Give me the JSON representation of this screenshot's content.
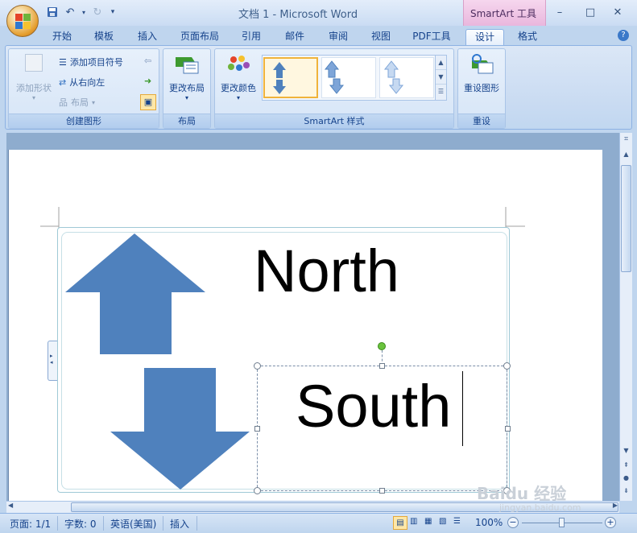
{
  "titlebar": {
    "title": "文档 1 - Microsoft Word",
    "context_tab": "SmartArt 工具",
    "minimize": "–",
    "maximize": "□",
    "close": "✕"
  },
  "tabs": [
    "开始",
    "模板",
    "插入",
    "页面布局",
    "引用",
    "邮件",
    "审阅",
    "视图",
    "PDF工具",
    "设计",
    "格式"
  ],
  "active_tab": "设计",
  "ribbon": {
    "create_group": {
      "label": "创建图形",
      "add_shape": "添加形状",
      "add_bullet": "添加项目符号",
      "right_to_left": "从右向左",
      "layout": "布局"
    },
    "layout_group": {
      "label": "布局",
      "change_layout": "更改布局"
    },
    "styles_group": {
      "label": "SmartArt 样式",
      "change_colors": "更改颜色"
    },
    "reset_group": {
      "label": "重设",
      "reset_graphic": "重设图形"
    }
  },
  "document": {
    "north_text": "North",
    "south_text": "South",
    "arrow_color": "#4f81bd"
  },
  "statusbar": {
    "page": "页面: 1/1",
    "words": "字数: 0",
    "language": "英语(美国)",
    "mode": "插入",
    "zoom": "100%",
    "zoom_out": "−",
    "zoom_in": "+"
  },
  "watermark": {
    "main": "Baidu 经验",
    "sub": "jingyan.baidu.com"
  }
}
